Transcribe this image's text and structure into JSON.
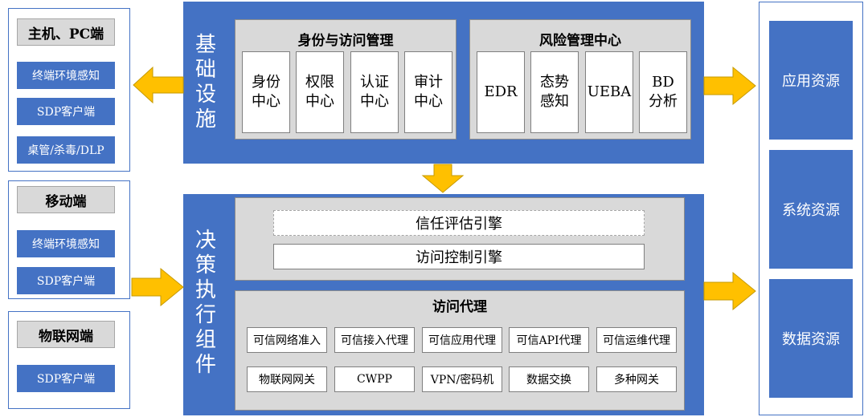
{
  "left": {
    "pc": {
      "title": "主机、PC端",
      "items": [
        "终端环境感知",
        "SDP客户端",
        "桌管/杀毒/DLP"
      ]
    },
    "mobile": {
      "title": "移动端",
      "items": [
        "终端环境感知",
        "SDP客户端"
      ]
    },
    "iot": {
      "title": "物联网端",
      "items": [
        "SDP客户端"
      ]
    }
  },
  "infra": {
    "label": "基础设施",
    "identity": {
      "title": "身份与访问管理",
      "items": [
        [
          "身份",
          "中心"
        ],
        [
          "权限",
          "中心"
        ],
        [
          "认证",
          "中心"
        ],
        [
          "审计",
          "中心"
        ]
      ]
    },
    "risk": {
      "title": "风险管理中心",
      "items": [
        [
          "EDR",
          ""
        ],
        [
          "态势",
          "感知"
        ],
        [
          "UEBA",
          ""
        ],
        [
          "BD",
          "分析"
        ]
      ]
    }
  },
  "decision": {
    "label": "决策执行组件",
    "engines": [
      "信任评估引擎",
      "访问控制引擎"
    ],
    "proxy": {
      "title": "访问代理",
      "row1": [
        "可信网络准入",
        "可信接入代理",
        "可信应用代理",
        "可信API代理",
        "可信运维代理"
      ],
      "row2": [
        "物联网网关",
        "CWPP",
        "VPN/密码机",
        "数据交换",
        "多种网关"
      ]
    }
  },
  "resources": [
    "应用资源",
    "系统资源",
    "数据资源"
  ],
  "colors": {
    "blue": "#4472c4",
    "gray": "#d9d9d9",
    "arrow": "#ffc000",
    "arrow_border": "#c69a00"
  }
}
